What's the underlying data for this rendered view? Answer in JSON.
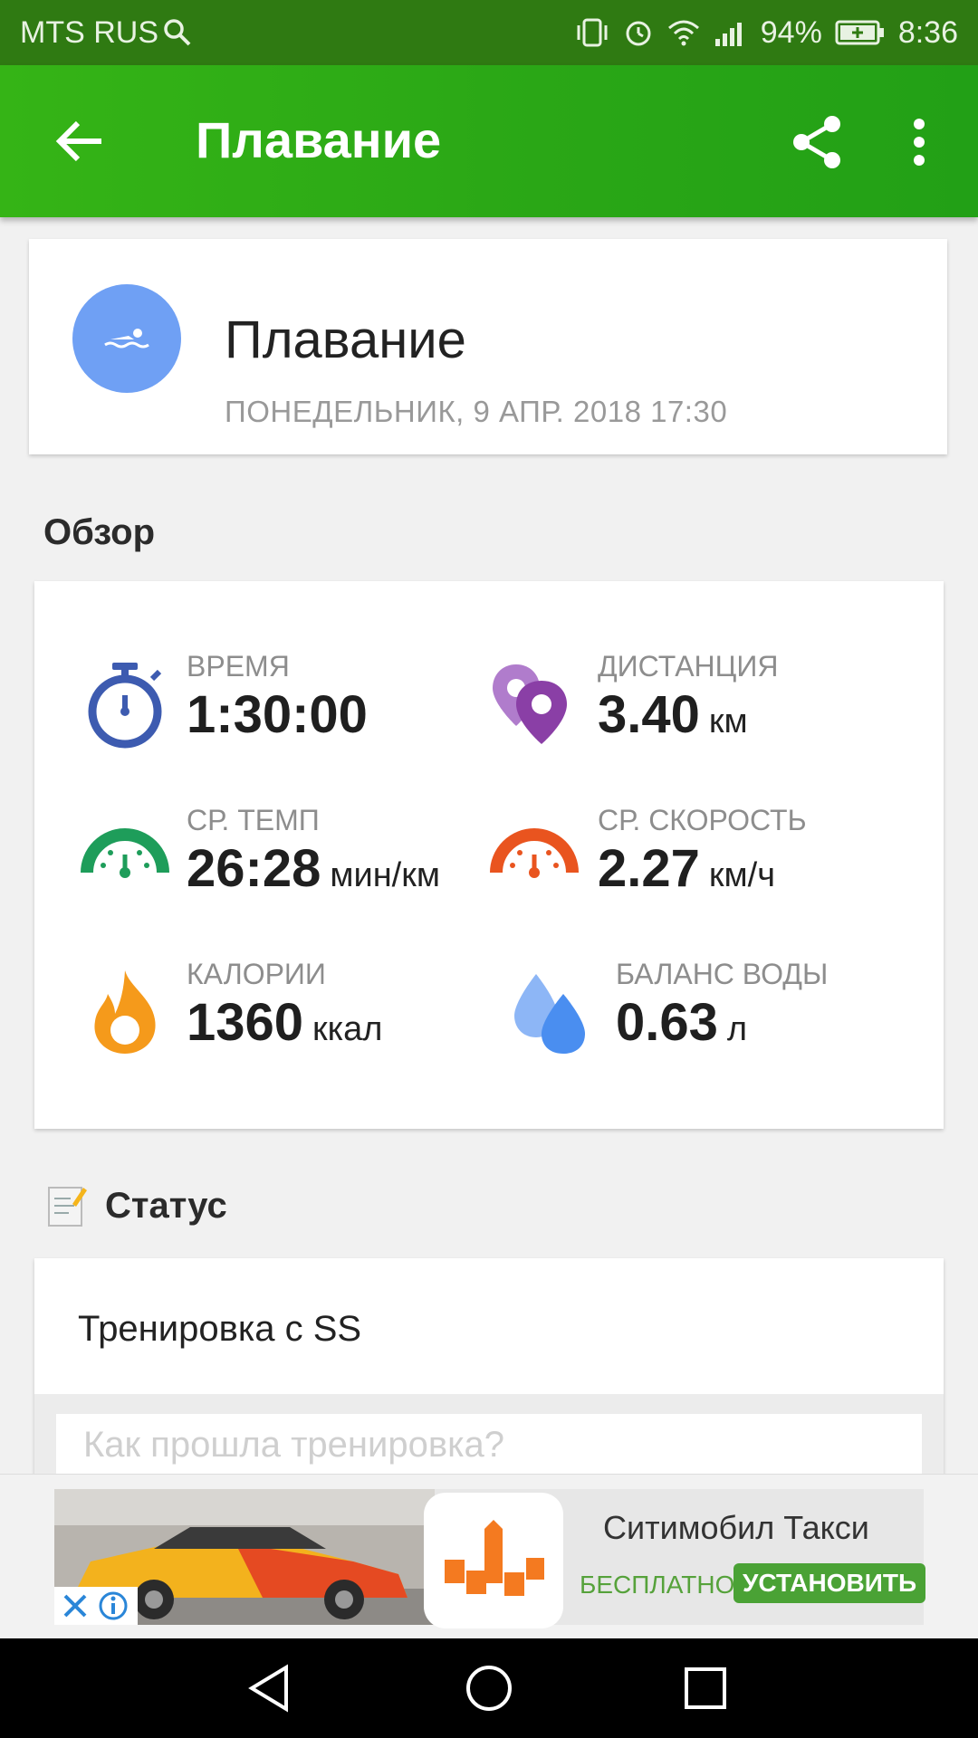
{
  "status_bar": {
    "carrier": "MTS RUS",
    "battery": "94%",
    "time": "8:36"
  },
  "app_bar": {
    "title": "Плавание",
    "back_icon": "arrow-back-icon",
    "share_icon": "share-icon",
    "more_icon": "more-vert-icon",
    "color": "#2aa716"
  },
  "activity": {
    "title": "Плавание",
    "datetime": "ПОНЕДЕЛЬНИК, 9 АПР. 2018 17:30",
    "icon": "swimmer-icon",
    "icon_color": "#6fa0f4"
  },
  "overview": {
    "title": "Обзор",
    "stats": [
      {
        "label": "ВРЕМЯ",
        "value": "1:30:00",
        "unit": "",
        "icon": "stopwatch-icon",
        "color": "#3d5bb0"
      },
      {
        "label": "ДИСТАНЦИЯ",
        "value": "3.40",
        "unit": "км",
        "icon": "location-pins-icon",
        "color": "#8a3fa6"
      },
      {
        "label": "СР. ТЕМП",
        "value": "26:28",
        "unit": "мин/км",
        "icon": "pace-gauge-icon",
        "color": "#1e9d5a"
      },
      {
        "label": "СР. СКОРОСТЬ",
        "value": "2.27",
        "unit": "км/ч",
        "icon": "speed-gauge-icon",
        "color": "#e9541f"
      },
      {
        "label": "КАЛОРИИ",
        "value": "1360",
        "unit": "ккал",
        "icon": "flame-icon",
        "color": "#f59a1b"
      },
      {
        "label": "БАЛАНС ВОДЫ",
        "value": "0.63",
        "unit": "л",
        "icon": "water-drops-icon",
        "color": "#4a8ef0"
      }
    ]
  },
  "status": {
    "title": "Статус",
    "icon": "note-pencil-icon",
    "text": "Тренировка с SS",
    "input_placeholder": "Как прошла тренировка?"
  },
  "ad": {
    "app_name": "Ситимобил Такси",
    "free_label": "БЕСПЛАТНО",
    "install_label": "УСТАНОВИТЬ",
    "close_icon": "close-icon",
    "info_icon": "info-icon"
  },
  "nav_bar": {
    "back_icon": "nav-back-icon",
    "home_icon": "nav-home-icon",
    "recents_icon": "nav-recents-icon"
  }
}
